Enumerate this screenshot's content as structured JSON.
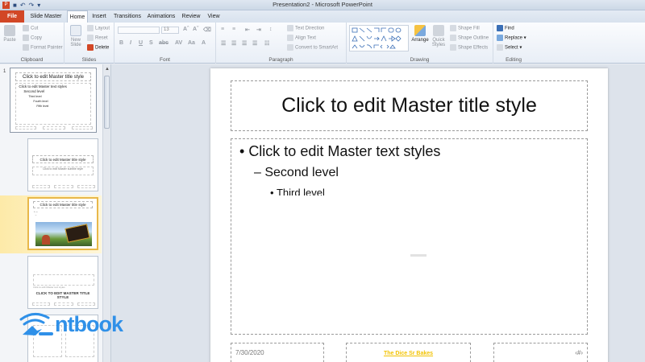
{
  "window": {
    "title": "Presentation2  -  Microsoft PowerPoint"
  },
  "tabs": [
    {
      "label": "File"
    },
    {
      "label": "Slide Master"
    },
    {
      "label": "Home"
    },
    {
      "label": "Insert"
    },
    {
      "label": "Transitions"
    },
    {
      "label": "Animations"
    },
    {
      "label": "Review"
    },
    {
      "label": "View"
    }
  ],
  "ribbon": {
    "clipboard": {
      "label": "Clipboard",
      "paste": "Paste",
      "cut": "Cut",
      "copy": "Copy",
      "format_painter": "Format Painter"
    },
    "slides": {
      "label": "Slides",
      "new_slide": "New Slide",
      "layout": "Layout",
      "reset": "Reset",
      "delete": "Delete"
    },
    "font": {
      "label": "Font",
      "size": "13"
    },
    "paragraph": {
      "label": "Paragraph",
      "text_direction": "Text Direction",
      "align_text": "Align Text",
      "convert_smartart": "Convert to SmartArt"
    },
    "drawing": {
      "label": "Drawing",
      "arrange": "Arrange",
      "quick_styles": "Quick Styles",
      "shape_fill": "Shape Fill",
      "shape_outline": "Shape Outline",
      "shape_effects": "Shape Effects"
    },
    "editing": {
      "label": "Editing",
      "find": "Find",
      "replace": "Replace",
      "select": "Select"
    }
  },
  "thumbnails": {
    "master_number": "1",
    "master_title": "Click to edit Master title style",
    "master_line1": "Click to edit Master text styles",
    "master_line2": "Second level",
    "master_line3": "Third level",
    "master_line4": "Fourth level",
    "master_line5": "Fifth level",
    "layout2_title": "Click to edit Master title style",
    "layout2_sub": "Click to edit Master subtitle style",
    "layout3_title": "Click to edit Master title style",
    "layout4_caps": "CLICK TO EDIT MASTER TITLE STYLE",
    "layout4_small": "Click to edit Master text styles"
  },
  "slide": {
    "title": "Click to edit Master title style",
    "level1": "Click to edit Master text styles",
    "level2": "Second level",
    "level3": "Third level",
    "footer_date": "7/30/2020",
    "footer_center": "The Dice Sr Bakes",
    "footer_number": "‹#›"
  },
  "watermark": {
    "brand": "ntbook"
  },
  "colors": {
    "file_tab": "#d24726",
    "selection": "#e8b84a",
    "brand": "#2f90e8"
  }
}
